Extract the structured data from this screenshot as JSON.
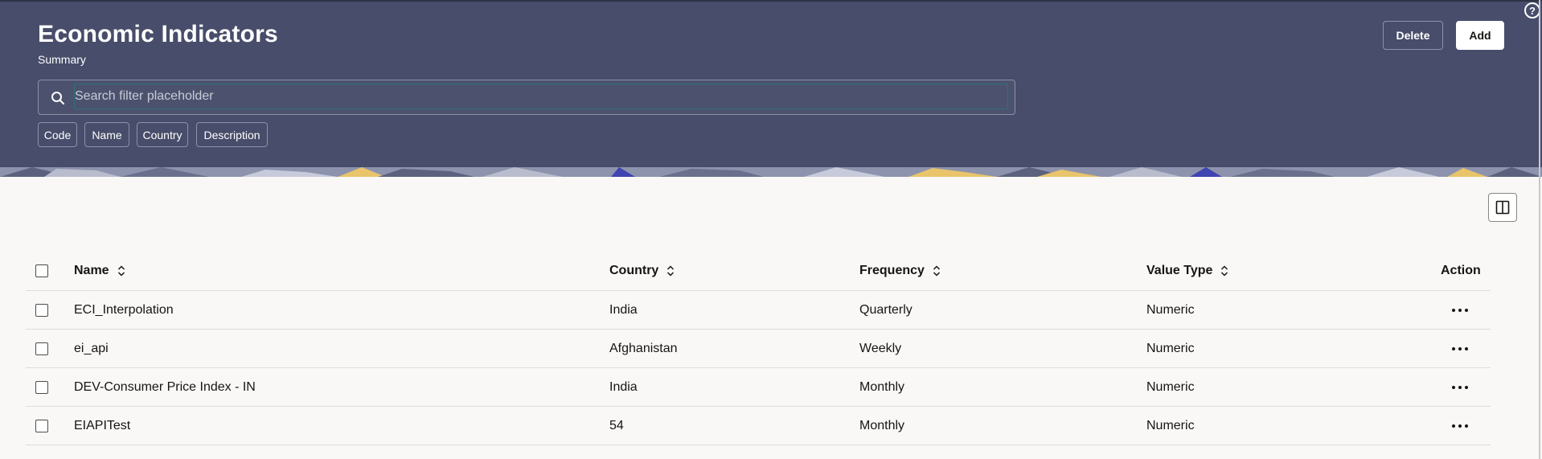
{
  "header": {
    "title": "Economic Indicators",
    "subtitle": "Summary",
    "delete_label": "Delete",
    "add_label": "Add",
    "help_glyph": "?"
  },
  "search": {
    "placeholder": "Search filter placeholder",
    "value": ""
  },
  "filter_chips": [
    "Code",
    "Name",
    "Country",
    "Description"
  ],
  "table": {
    "columns": [
      "Name",
      "Country",
      "Frequency",
      "Value Type",
      "Action"
    ],
    "rows": [
      {
        "name": "ECI_Interpolation",
        "country": "India",
        "frequency": "Quarterly",
        "value_type": "Numeric"
      },
      {
        "name": "ei_api",
        "country": "Afghanistan",
        "frequency": "Weekly",
        "value_type": "Numeric"
      },
      {
        "name": "DEV-Consumer Price Index - IN",
        "country": "India",
        "frequency": "Monthly",
        "value_type": "Numeric"
      },
      {
        "name": "EIAPITest",
        "country": "54",
        "frequency": "Monthly",
        "value_type": "Numeric"
      }
    ]
  },
  "icons": {
    "search": "search-icon",
    "help": "help-icon",
    "panel_toggle": "panel-toggle-icon",
    "sort": "sort-icon",
    "action": "more-horizontal-icon"
  },
  "colors": {
    "header_bg": "#474d6a",
    "page_bg": "#f9f8f6",
    "text": "#161513"
  }
}
